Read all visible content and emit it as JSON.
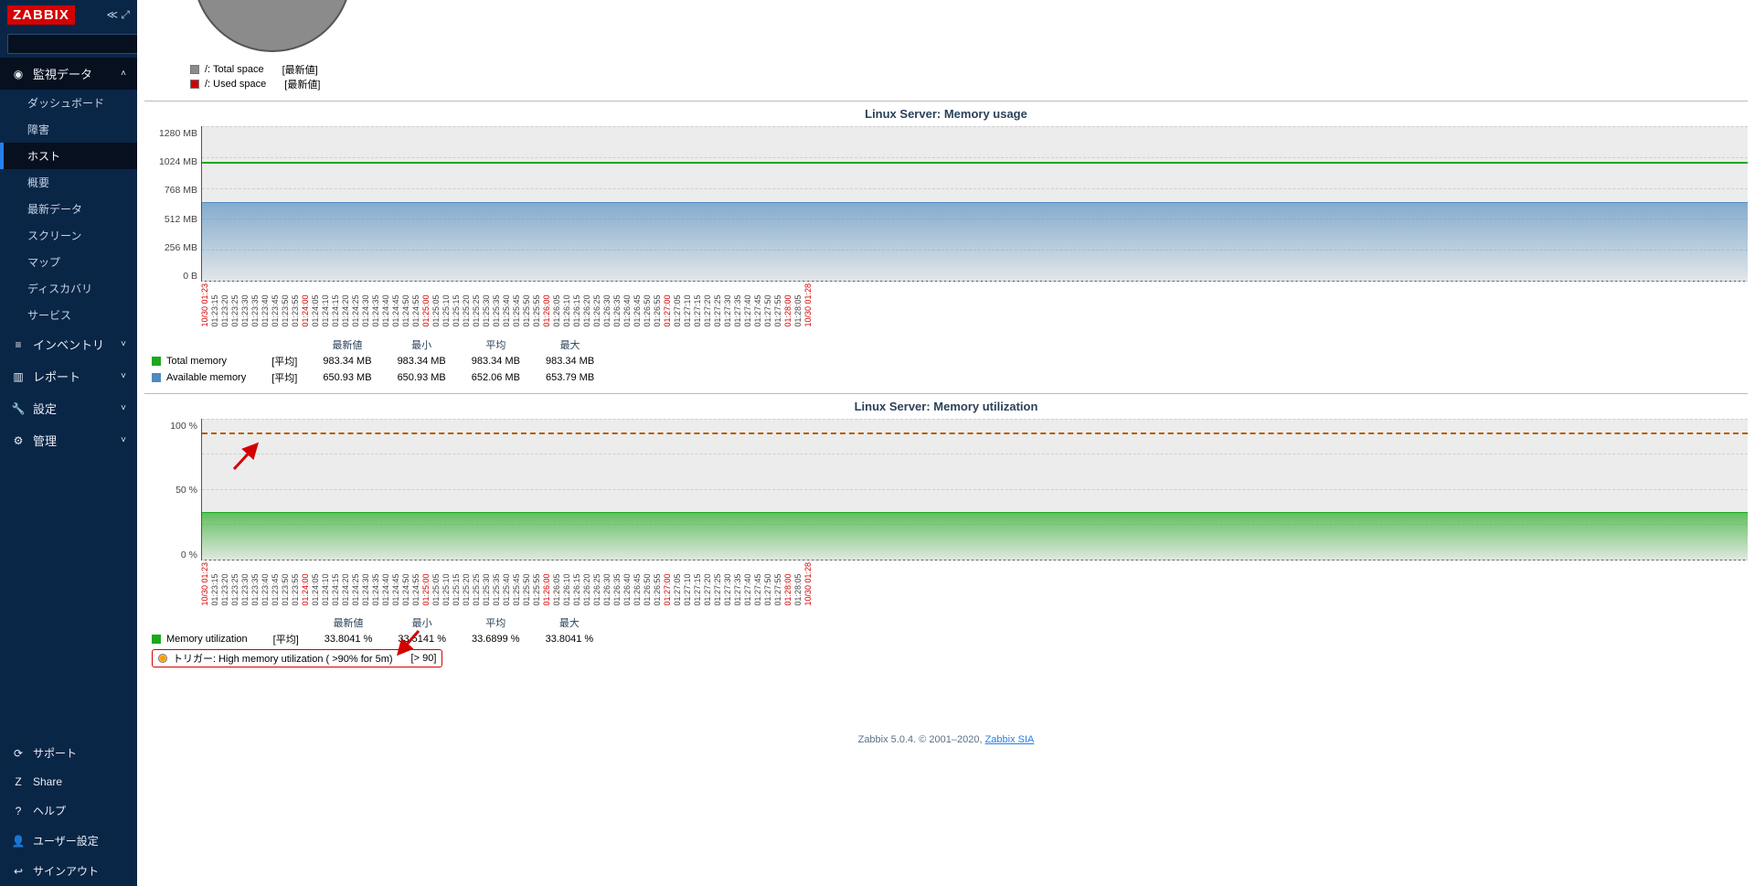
{
  "brand": "ZABBIX",
  "search": {
    "placeholder": ""
  },
  "sidebar": {
    "sections": [
      {
        "icon": "◉",
        "label": "監視データ",
        "expanded": true,
        "items": [
          {
            "label": "ダッシュボード"
          },
          {
            "label": "障害"
          },
          {
            "label": "ホスト",
            "active": true
          },
          {
            "label": "概要"
          },
          {
            "label": "最新データ"
          },
          {
            "label": "スクリーン"
          },
          {
            "label": "マップ"
          },
          {
            "label": "ディスカバリ"
          },
          {
            "label": "サービス"
          }
        ]
      },
      {
        "icon": "≡",
        "label": "インベントリ"
      },
      {
        "icon": "▥",
        "label": "レポート"
      },
      {
        "icon": "🔧",
        "label": "設定"
      },
      {
        "icon": "⚙",
        "label": "管理"
      }
    ],
    "bottom": [
      {
        "icon": "⟳",
        "label": "サポート"
      },
      {
        "icon": "Z",
        "label": "Share"
      },
      {
        "icon": "?",
        "label": "ヘルプ"
      },
      {
        "icon": "👤",
        "label": "ユーザー設定"
      },
      {
        "icon": "↩",
        "label": "サインアウト"
      }
    ]
  },
  "disk_legend": {
    "total_label": "/: Total space",
    "total_stat": "[最新値]",
    "used_label": "/: Used space",
    "used_stat": "[最新値]"
  },
  "chart_data": [
    {
      "type": "line",
      "title": "Linux Server: Memory usage",
      "ylabel": "",
      "ylim": [
        0,
        1280
      ],
      "yticks": [
        "1280 MB",
        "1024 MB",
        "768 MB",
        "512 MB",
        "256 MB",
        "0 B"
      ],
      "x": [
        "10/30 01:23",
        "01:23:15",
        "01:23:20",
        "01:23:25",
        "01:23:30",
        "01:23:35",
        "01:23:40",
        "01:23:45",
        "01:23:50",
        "01:23:55",
        "01:24:00",
        "01:24:05",
        "01:24:10",
        "01:24:15",
        "01:24:20",
        "01:24:25",
        "01:24:30",
        "01:24:35",
        "01:24:40",
        "01:24:45",
        "01:24:50",
        "01:24:55",
        "01:25:00",
        "01:25:05",
        "01:25:10",
        "01:25:15",
        "01:25:20",
        "01:25:25",
        "01:25:30",
        "01:25:35",
        "01:25:40",
        "01:25:45",
        "01:25:50",
        "01:25:55",
        "01:26:00",
        "01:26:05",
        "01:26:10",
        "01:26:15",
        "01:26:20",
        "01:26:25",
        "01:26:30",
        "01:26:35",
        "01:26:40",
        "01:26:45",
        "01:26:50",
        "01:26:55",
        "01:27:00",
        "01:27:05",
        "01:27:10",
        "01:27:15",
        "01:27:20",
        "01:27:25",
        "01:27:30",
        "01:27:35",
        "01:27:40",
        "01:27:45",
        "01:27:50",
        "01:27:55",
        "01:28:00",
        "01:28:05",
        "10/30 01:28"
      ],
      "x_red": [
        0,
        10,
        22,
        34,
        46,
        58,
        60
      ],
      "series": [
        {
          "name": "Total memory",
          "color": "#1ca81c",
          "value": 983.34
        },
        {
          "name": "Available memory",
          "color": "#4f8bbf",
          "fill": true,
          "value": 650.93
        }
      ],
      "legend_headers": [
        "",
        "",
        "最新値",
        "最小",
        "平均",
        "最大"
      ],
      "legend_rows": [
        {
          "sw": "#1ca81c",
          "name": "Total memory",
          "agg": "[平均]",
          "v": [
            "983.34 MB",
            "983.34 MB",
            "983.34 MB",
            "983.34 MB"
          ]
        },
        {
          "sw": "#4f8bbf",
          "name": "Available memory",
          "agg": "[平均]",
          "v": [
            "650.93 MB",
            "650.93 MB",
            "652.06 MB",
            "653.79 MB"
          ]
        }
      ]
    },
    {
      "type": "area",
      "title": "Linux Server: Memory utilization",
      "ylabel": "",
      "ylim": [
        0,
        100
      ],
      "yticks": [
        "100 %",
        "",
        "50 %",
        "",
        "0 %"
      ],
      "x": [
        "10/30 01:23",
        "01:23:15",
        "01:23:20",
        "01:23:25",
        "01:23:30",
        "01:23:35",
        "01:23:40",
        "01:23:45",
        "01:23:50",
        "01:23:55",
        "01:24:00",
        "01:24:05",
        "01:24:10",
        "01:24:15",
        "01:24:20",
        "01:24:25",
        "01:24:30",
        "01:24:35",
        "01:24:40",
        "01:24:45",
        "01:24:50",
        "01:24:55",
        "01:25:00",
        "01:25:05",
        "01:25:10",
        "01:25:15",
        "01:25:20",
        "01:25:25",
        "01:25:30",
        "01:25:35",
        "01:25:40",
        "01:25:45",
        "01:25:50",
        "01:25:55",
        "01:26:00",
        "01:26:05",
        "01:26:10",
        "01:26:15",
        "01:26:20",
        "01:26:25",
        "01:26:30",
        "01:26:35",
        "01:26:40",
        "01:26:45",
        "01:26:50",
        "01:26:55",
        "01:27:00",
        "01:27:05",
        "01:27:10",
        "01:27:15",
        "01:27:20",
        "01:27:25",
        "01:27:30",
        "01:27:35",
        "01:27:40",
        "01:27:45",
        "01:27:50",
        "01:27:55",
        "01:28:00",
        "01:28:05",
        "10/30 01:28"
      ],
      "x_red": [
        0,
        10,
        22,
        34,
        46,
        58,
        60
      ],
      "series": [
        {
          "name": "Memory utilization",
          "color": "#1ca81c",
          "fill": true,
          "value": 33.8
        }
      ],
      "trigger_line": 90,
      "legend_headers": [
        "",
        "",
        "最新値",
        "最小",
        "平均",
        "最大"
      ],
      "legend_rows": [
        {
          "sw": "#1ca81c",
          "name": "Memory utilization",
          "agg": "[平均]",
          "v": [
            "33.8041 %",
            "33.5141 %",
            "33.6899 %",
            "33.8041 %"
          ]
        }
      ],
      "trigger_legend": {
        "label": "トリガー: High memory utilization ( >90% for 5m)",
        "cond": "[> 90]"
      }
    }
  ],
  "footer": {
    "text": "Zabbix 5.0.4. © 2001–2020, ",
    "link": "Zabbix SIA"
  }
}
